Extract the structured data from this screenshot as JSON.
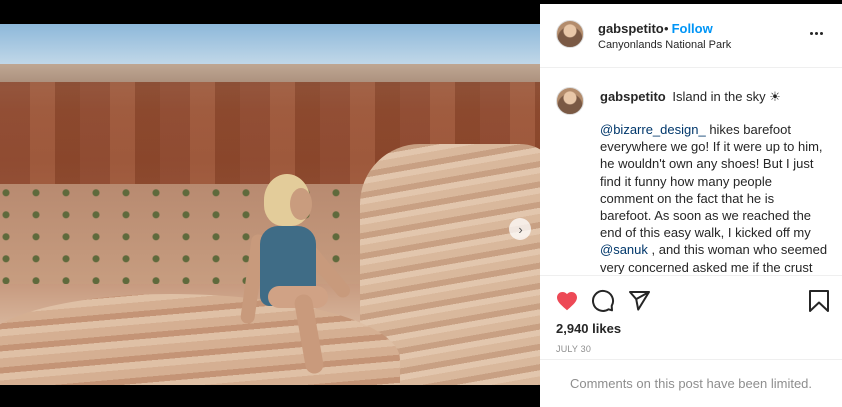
{
  "post": {
    "username": "gabspetito",
    "follow_label": "Follow",
    "separator": "•",
    "location": "Canyonlands National Park",
    "carousel": {
      "dot_count": 3,
      "active_index": 0,
      "next_icon": "chevron-right"
    },
    "caption": {
      "username": "gabspetito",
      "title": "Island in the sky ☀",
      "mention1": "@bizarre_design_",
      "text1": " hikes barefoot everywhere we go! If it were up to him, he wouldn't own any shoes! But I just find it funny how many people comment on the fact that he is barefoot. As soon as we reached the end of this easy walk, I kicked off my ",
      "mention2": "@sanuk",
      "text2": " , and this woman who seemed very concerned asked me if the crust was hot. I was in such a"
    },
    "actions": {
      "like_icon": "heart-filled-icon",
      "comment_icon": "comment-icon",
      "share_icon": "send-icon",
      "save_icon": "bookmark-icon",
      "like_color": "#ed4956"
    },
    "likes": "2,940 likes",
    "date": "JULY 30",
    "comments_limited": "Comments on this post have been limited."
  }
}
